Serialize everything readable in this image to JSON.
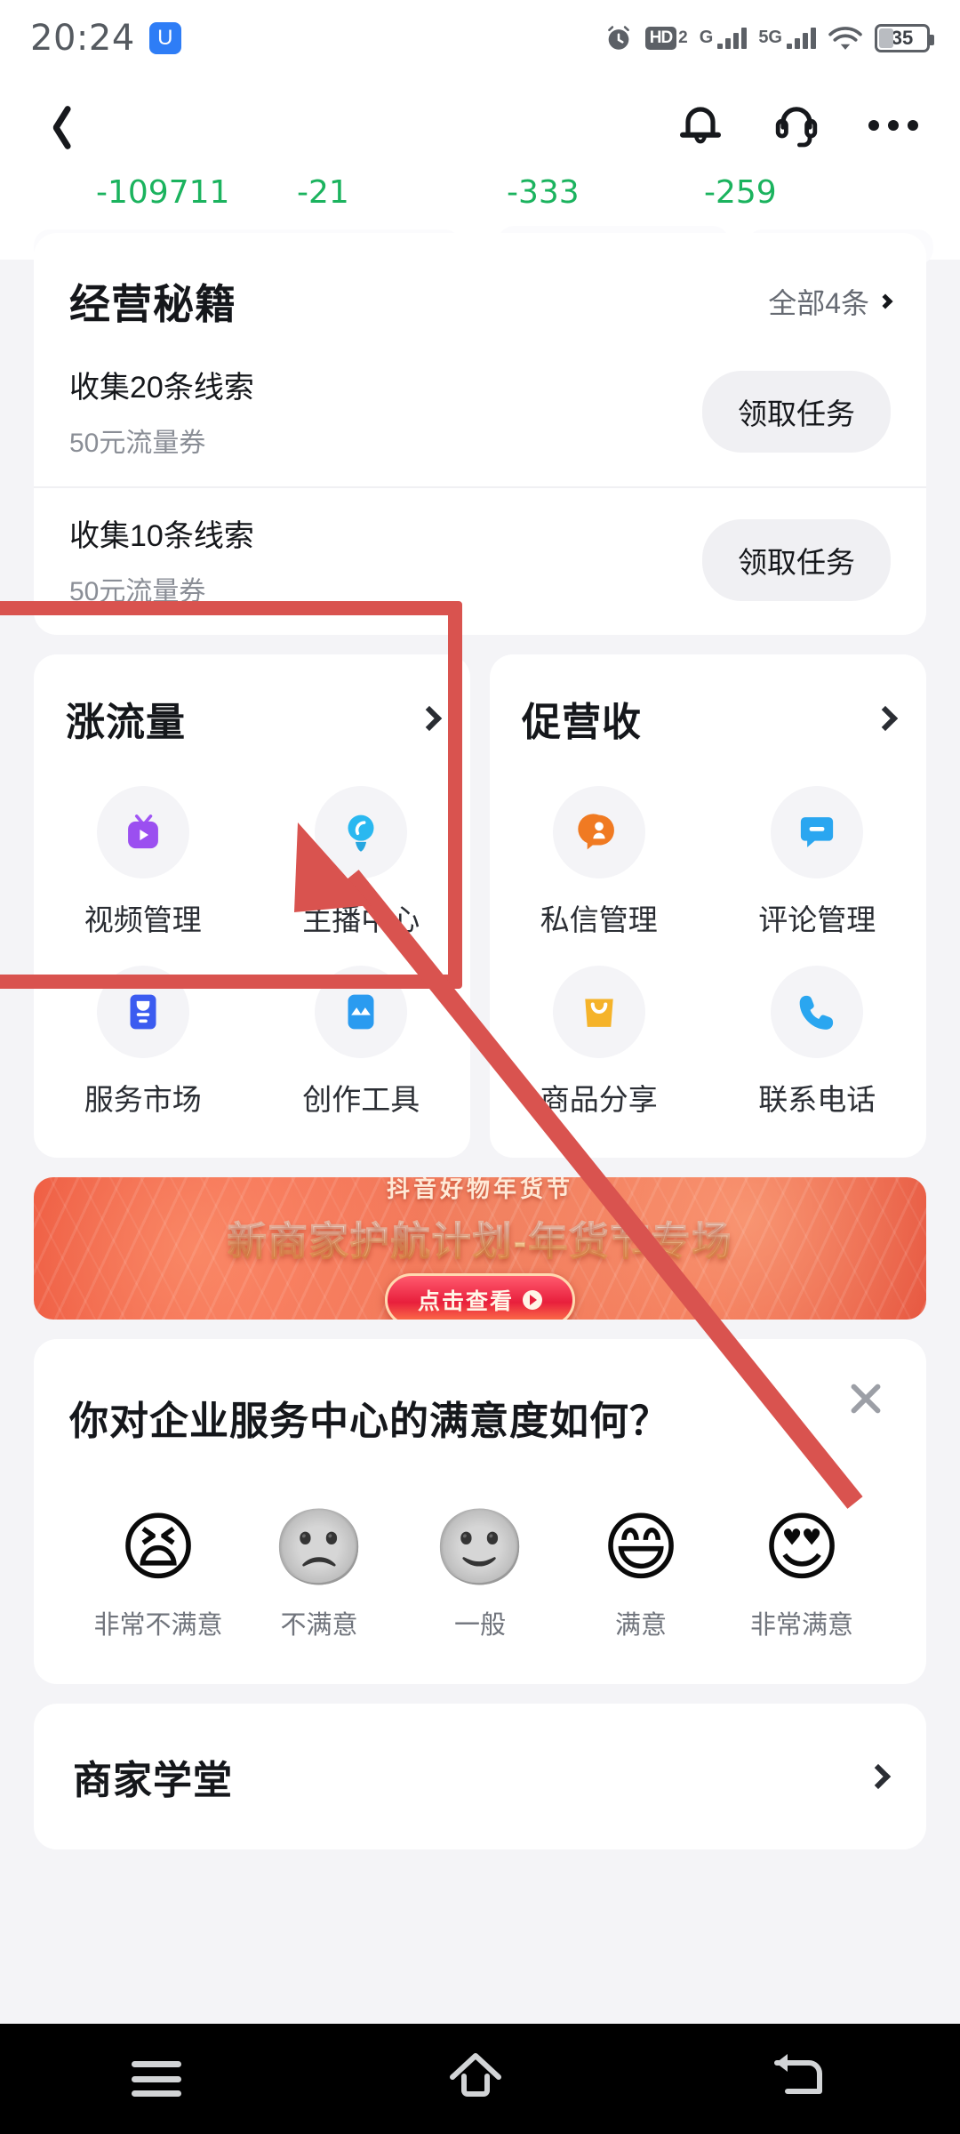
{
  "status_bar": {
    "time": "20:24",
    "app_badge_glyph": "U",
    "icons": [
      "alarm-icon",
      "hd2-icon",
      "signal-g-icon",
      "signal-5g-icon",
      "wifi-icon",
      "battery-icon"
    ],
    "hd_label": "HD",
    "hd_sub": "2",
    "net_g_label": "G",
    "net_5g_label": "5G",
    "battery_level": "35"
  },
  "app_bar": {
    "back_icon": "back-chevron-icon",
    "bell_icon": "bell-icon",
    "service_icon": "headset-icon",
    "more_icon": "more-dots-icon"
  },
  "stats_strip": {
    "values": [
      "-109711",
      "-21",
      "-333",
      "-259"
    ],
    "color": "#1bb35e"
  },
  "secrets_card": {
    "title": "经营秘籍",
    "all_label": "全部4条",
    "rows": [
      {
        "line1": "收集20条线索",
        "line2": "50元流量券",
        "button": "领取任务"
      },
      {
        "line1": "收集10条线索",
        "line2": "50元流量券",
        "button": "领取任务"
      }
    ]
  },
  "feature_cards": [
    {
      "title": "涨流量",
      "tiles": [
        {
          "label": "视频管理",
          "icon": "video-manage-icon",
          "color": "#9b4ff0"
        },
        {
          "label": "主播中心",
          "icon": "anchor-center-icon",
          "color": "#2ab8f0"
        },
        {
          "label": "服务市场",
          "icon": "service-market-icon",
          "color": "#3b5bf0"
        },
        {
          "label": "创作工具",
          "icon": "creation-tools-icon",
          "color": "#2a9bf0"
        }
      ]
    },
    {
      "title": "促营收",
      "tiles": [
        {
          "label": "私信管理",
          "icon": "direct-message-icon",
          "color": "#f07a22"
        },
        {
          "label": "评论管理",
          "icon": "comment-manage-icon",
          "color": "#2aa6f0"
        },
        {
          "label": "商品分享",
          "icon": "goods-share-icon",
          "color": "#f5b32a"
        },
        {
          "label": "联系电话",
          "icon": "phone-icon",
          "color": "#2aa6f0"
        }
      ]
    }
  ],
  "banner": {
    "sub_title": "抖音好物年货节",
    "main_title": "新商家护航计划-年货节专场",
    "cta": "点击查看",
    "cta_icon": "play-circle-icon"
  },
  "survey": {
    "question": "你对企业服务中心的满意度如何？",
    "close_icon": "close-icon",
    "options": [
      {
        "label": "非常不满意",
        "face": "😫",
        "icon": "face-very-unsatisfied-icon"
      },
      {
        "label": "不满意",
        "face": "🙁",
        "icon": "face-unsatisfied-icon"
      },
      {
        "label": "一般",
        "face": "🙂",
        "icon": "face-neutral-icon"
      },
      {
        "label": "满意",
        "face": "😄",
        "icon": "face-satisfied-icon"
      },
      {
        "label": "非常满意",
        "face": "😍",
        "icon": "face-very-satisfied-icon"
      }
    ]
  },
  "school_card": {
    "title": "商家学堂",
    "chevron_icon": "chevron-right-icon"
  },
  "annotation": {
    "color": "#d9534f",
    "box_label": "highlight-box",
    "arrow_label": "pointer-arrow"
  },
  "nav_bar": {
    "menu_icon": "menu-icon",
    "home_icon": "home-icon",
    "back_icon": "back-icon"
  }
}
